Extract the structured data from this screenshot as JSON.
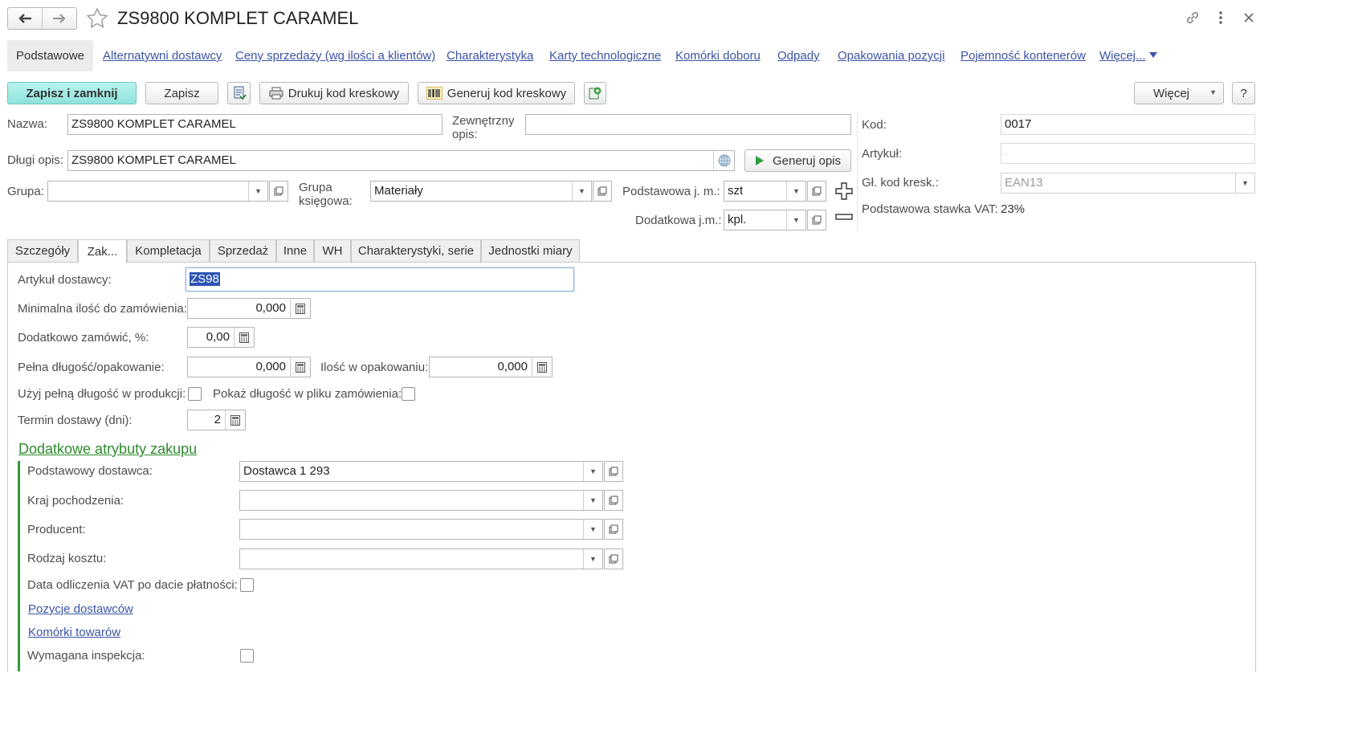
{
  "window": {
    "title": "ZS9800 KOMPLET CARAMEL",
    "back_icon": "arrow-left-icon",
    "forward_icon": "arrow-right-icon",
    "favorite_icon": "star-icon",
    "link_icon": "link-icon",
    "menu_icon": "more-vertical-icon",
    "close_icon": "close-icon"
  },
  "topnav": {
    "active": "Podstawowe",
    "links": [
      "Alternatywni dostawcy",
      "Ceny sprzedaży (wg ilości a klientów)",
      "Charakterystyka",
      "Karty technologiczne",
      "Komórki doboru",
      "Odpady",
      "Opakowania pozycji",
      "Pojemność kontenerów",
      "Więcej..."
    ]
  },
  "toolbar": {
    "save_close": "Zapisz i zamknij",
    "save": "Zapisz",
    "print_barcode": "Drukuj kod kreskowy",
    "gen_barcode": "Generuj kod kreskowy",
    "more": "Więcej",
    "help": "?"
  },
  "header": {
    "name_label": "Nazwa:",
    "name_value": "ZS9800 KOMPLET CARAMEL",
    "ext_desc_label_1": "Zewnętrzny",
    "ext_desc_label_2": "opis:",
    "ext_desc_value": "",
    "long_desc_label": "Długi opis:",
    "long_desc_value": "ZS9800 KOMPLET CARAMEL",
    "gen_desc_button": "Generuj opis",
    "group_label": "Grupa:",
    "group_value": "",
    "acc_group_label_1": "Grupa",
    "acc_group_label_2": "księgowa:",
    "acc_group_value": "Materiały",
    "base_unit_label": "Podstawowa  j. m.:",
    "base_unit_value": "szt",
    "extra_unit_label": "Dodatkowa j.m.:",
    "extra_unit_value": "kpl.",
    "code_label": "Kod:",
    "code_value": "0017",
    "article_label": "Artykuł:",
    "article_value": ".",
    "barcode_label": "Gł. kod kresk.:",
    "barcode_value": "EAN13",
    "vat_label": "Podstawowa stawka VAT:",
    "vat_value": "23%"
  },
  "tabs": [
    "Szczegóły",
    "Zak...",
    "Kompletacja",
    "Sprzedaż",
    "Inne",
    "WH",
    "Charakterystyki, serie",
    "Jednostki miary"
  ],
  "purchase": {
    "supplier_article_label": "Artykuł dostawcy:",
    "supplier_article_value": "ZS98",
    "min_qty_label": "Minimalna ilość do zamówienia:",
    "min_qty_value": "0,000",
    "extra_order_label": "Dodatkowo zamówić, %:",
    "extra_order_value": "0,00",
    "full_length_label": "Pełna długość/opakowanie:",
    "full_length_value": "0,000",
    "pack_qty_label": "Ilość w opakowaniu:",
    "pack_qty_value": "0,000",
    "use_full_length_label": "Użyj pełną długość w produkcji:",
    "show_length_label": "Pokaż długość w pliku zamówienia:",
    "lead_time_label": "Termin dostawy (dni):",
    "lead_time_value": "2"
  },
  "extra_attrs": {
    "title": "Dodatkowe atrybuty zakupu",
    "base_supplier_label": "Podstawowy dostawca:",
    "base_supplier_value": "Dostawca 1 293",
    "origin_label": "Kraj pochodzenia:",
    "origin_value": "",
    "producer_label": "Producent:",
    "producer_value": "",
    "cost_type_label": "Rodzaj kosztu:",
    "cost_type_value": "",
    "vat_date_label": "Data odliczenia VAT po dacie płatności:",
    "supplier_items_link": "Pozycje dostawców",
    "item_cells_link": "Komórki towarów",
    "inspection_label": "Wymagana inspekcja:"
  },
  "colors": {
    "accent": "#8fe3dc",
    "link": "#3a54a4",
    "section": "#2e8b2e"
  }
}
